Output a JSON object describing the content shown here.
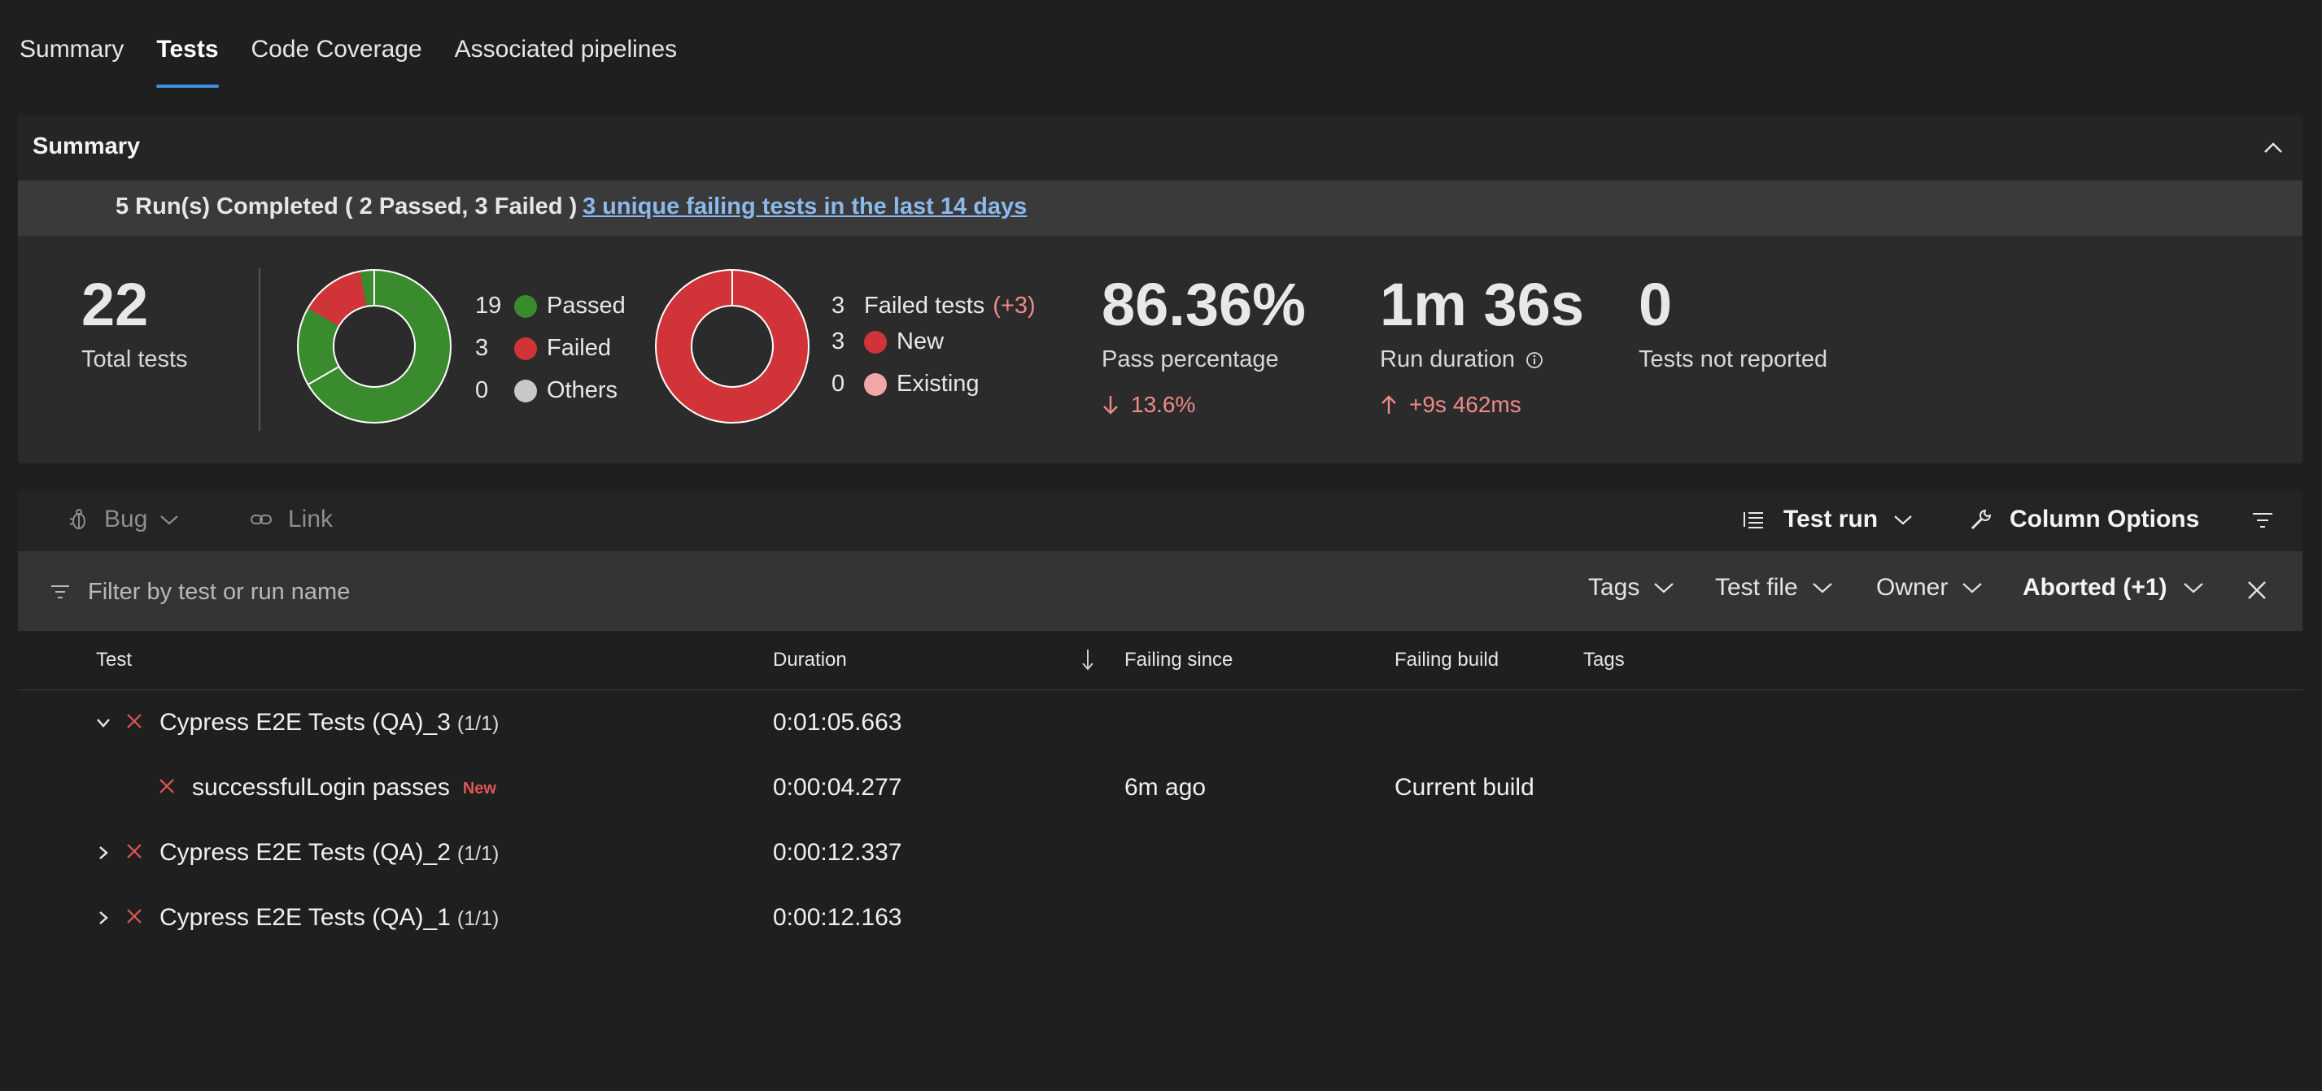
{
  "tabs": [
    {
      "label": "Summary"
    },
    {
      "label": "Tests"
    },
    {
      "label": "Code Coverage"
    },
    {
      "label": "Associated pipelines"
    }
  ],
  "summary": {
    "title": "Summary",
    "banner_text": "5 Run(s) Completed ( 2 Passed, 3 Failed )",
    "banner_link": "3 unique failing tests in the last 14 days",
    "total_tests": {
      "value": "22",
      "label": "Total tests"
    },
    "outcome": {
      "passed": {
        "count": "19",
        "label": "Passed",
        "color": "#3a8a2e"
      },
      "failed": {
        "count": "3",
        "label": "Failed",
        "color": "#d13438"
      },
      "others": {
        "count": "0",
        "label": "Others",
        "color": "#c8c8c8"
      }
    },
    "failed_tests": {
      "count": "3",
      "label": "Failed tests",
      "delta": "(+3)",
      "new": {
        "count": "3",
        "label": "New",
        "color": "#d13438"
      },
      "existing": {
        "count": "0",
        "label": "Existing",
        "color": "#f1a8a8"
      }
    },
    "pass_percentage": {
      "value": "86.36%",
      "label": "Pass percentage",
      "delta": "13.6%"
    },
    "run_duration": {
      "value": "1m 36s",
      "label": "Run duration",
      "delta": "+9s 462ms"
    },
    "not_reported": {
      "value": "0",
      "label": "Tests not reported"
    }
  },
  "toolbar": {
    "bug": "Bug",
    "link": "Link",
    "test_run": "Test run",
    "column_options": "Column Options"
  },
  "filter": {
    "placeholder": "Filter by test or run name",
    "tags": "Tags",
    "test_file": "Test file",
    "owner": "Owner",
    "outcome": "Aborted (+1)"
  },
  "table": {
    "headers": {
      "test": "Test",
      "duration": "Duration",
      "failing_since": "Failing since",
      "failing_build": "Failing build",
      "tags": "Tags"
    },
    "rows": [
      {
        "name": "Cypress E2E Tests (QA)_3",
        "count": "(1/1)",
        "duration": "0:01:05.663"
      },
      {
        "name": "successfulLogin passes",
        "tag": "New",
        "duration": "0:00:04.277",
        "failing_since": "6m ago",
        "failing_build": "Current build"
      },
      {
        "name": "Cypress E2E Tests (QA)_2",
        "count": "(1/1)",
        "duration": "0:00:12.337"
      },
      {
        "name": "Cypress E2E Tests (QA)_1",
        "count": "(1/1)",
        "duration": "0:00:12.163"
      }
    ]
  }
}
